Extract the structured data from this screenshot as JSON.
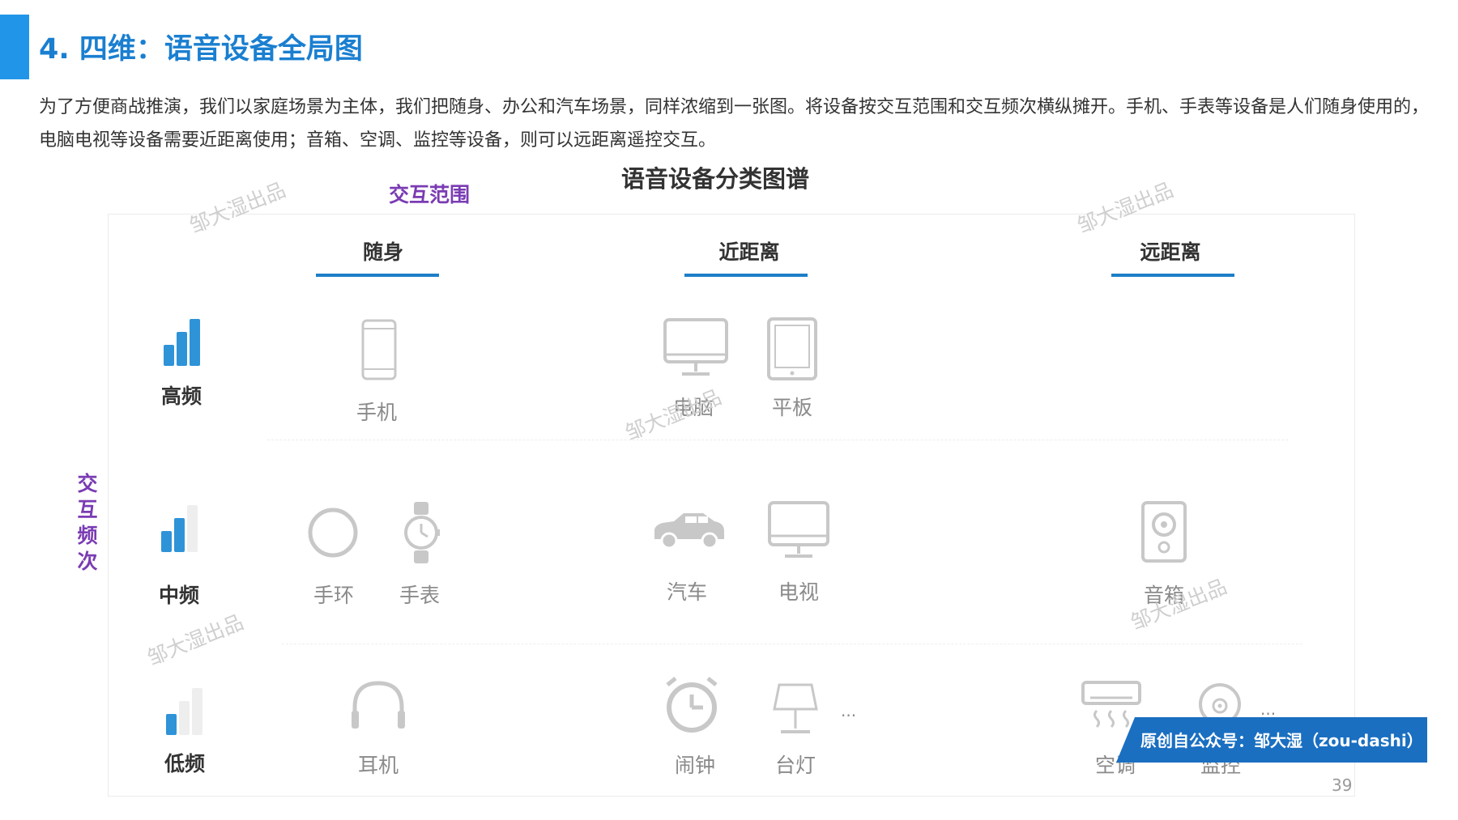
{
  "slide": {
    "title": "4. 四维：语音设备全局图",
    "intro": "为了方便商战推演，我们以家庭场景为主体，我们把随身、办公和汽车场景，同样浓缩到一张图。将设备按交互范围和交互频次横纵摊开。手机、手表等设备是人们随身使用的，电脑电视等设备需要近距离使用；音箱、空调、监控等设备，则可以远距离遥控交互。",
    "page_number": "39"
  },
  "map": {
    "title": "语音设备分类图谱",
    "range_axis_label": "交互范围",
    "frequency_axis_label": "交互频次",
    "columns": [
      "随身",
      "近距离",
      "远距离"
    ],
    "rows": [
      {
        "label": "高频",
        "signal_level": 3
      },
      {
        "label": "中频",
        "signal_level": 2
      },
      {
        "label": "低频",
        "signal_level": 1
      }
    ],
    "devices": {
      "phone": {
        "label": "手机",
        "icon": "phone-icon"
      },
      "computer": {
        "label": "电脑",
        "icon": "monitor-icon"
      },
      "tablet": {
        "label": "平板",
        "icon": "tablet-icon"
      },
      "band": {
        "label": "手环",
        "icon": "band-icon"
      },
      "watch": {
        "label": "手表",
        "icon": "watch-icon"
      },
      "car": {
        "label": "汽车",
        "icon": "car-icon"
      },
      "tv": {
        "label": "电视",
        "icon": "tv-icon"
      },
      "speaker": {
        "label": "音箱",
        "icon": "speaker-icon"
      },
      "earphone": {
        "label": "耳机",
        "icon": "headphone-icon"
      },
      "alarm": {
        "label": "闹钟",
        "icon": "alarm-clock-icon"
      },
      "lamp": {
        "label": "台灯",
        "icon": "lamp-icon"
      },
      "ac": {
        "label": "空调",
        "icon": "air-conditioner-icon"
      },
      "camera": {
        "label": "监控",
        "icon": "camera-icon"
      }
    },
    "ellipsis": "..."
  },
  "watermark": "邹大湿出品",
  "banner": "原创自公众号：邹大湿（zou-dashi）",
  "colors": {
    "title_blue": "#1a7fd0",
    "accent": "#2196e8",
    "axis_purple": "#7a3bb3",
    "column_underline": "#1e7fc8",
    "signal_active": "#2f93d8",
    "signal_inactive": "#eeeeee",
    "icon_gray": "#c8c8c8",
    "banner_blue": "#1a6fc1"
  }
}
